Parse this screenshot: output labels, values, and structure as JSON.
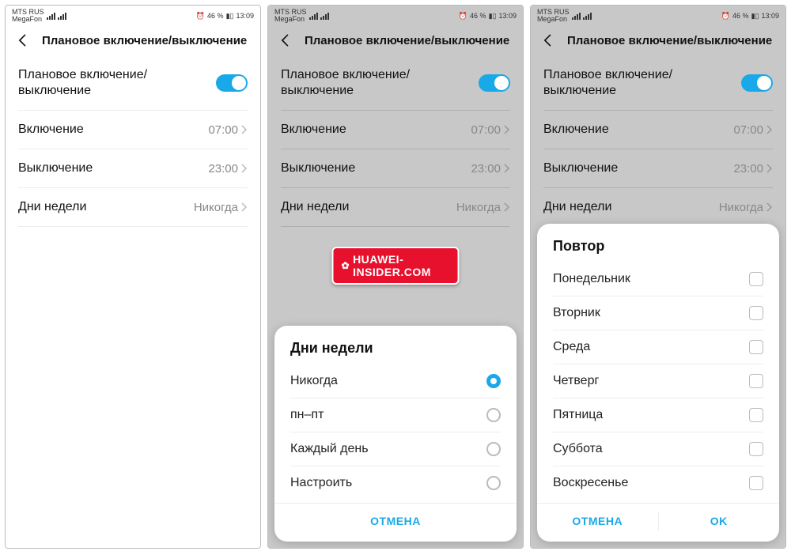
{
  "status": {
    "carrier1": "MTS RUS",
    "carrier2": "MegaFon",
    "battery_pct": "46 %",
    "time": "13:09"
  },
  "header": {
    "title": "Плановое включение/выключение"
  },
  "rows": {
    "toggle_label": "Плановое включение/\nвыключение",
    "on_label": "Включение",
    "on_value": "07:00",
    "off_label": "Выключение",
    "off_value": "23:00",
    "days_label": "Дни недели",
    "days_value": "Никогда"
  },
  "watermark": "HUAWEI-INSIDER.COM",
  "sheet_days": {
    "title": "Дни недели",
    "options": [
      "Никогда",
      "пн–пт",
      "Каждый день",
      "Настроить"
    ],
    "selected": 0,
    "cancel": "ОТМЕНА"
  },
  "sheet_repeat": {
    "title": "Повтор",
    "options": [
      "Понедельник",
      "Вторник",
      "Среда",
      "Четверг",
      "Пятница",
      "Суббота",
      "Воскресенье"
    ],
    "cancel": "ОТМЕНА",
    "ok": "OK"
  }
}
